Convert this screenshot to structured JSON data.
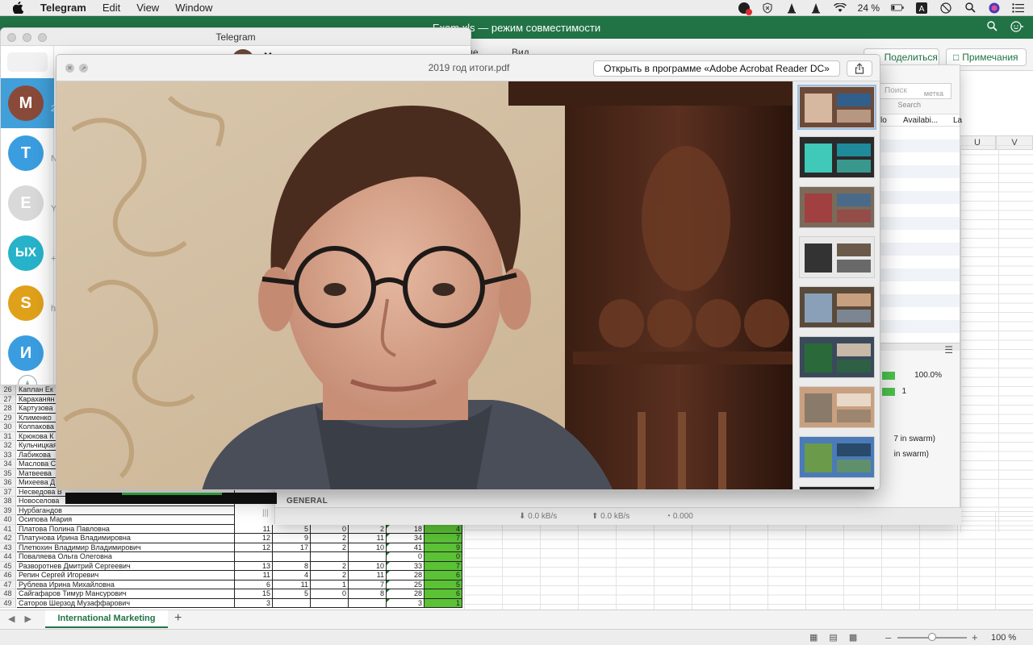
{
  "menubar": {
    "app": "Telegram",
    "items": [
      "Edit",
      "View",
      "Window"
    ],
    "battery": "24 %"
  },
  "excel": {
    "title": "Exam.xls — режим совместимости",
    "share_label": "Поделиться",
    "comments_label": "Примечания",
    "tab_partial_1": "ание",
    "tab_partial_2": "Вид",
    "columns": [
      "U",
      "V"
    ],
    "sheet_tab": "International Marketing",
    "zoom_level": "100 %",
    "rows": [
      {
        "n": "26",
        "name": "Каплан Ек",
        "v": [
          "",
          "",
          "",
          "",
          "",
          ""
        ]
      },
      {
        "n": "27",
        "name": "Караханян",
        "v": [
          "",
          "",
          "",
          "",
          "",
          ""
        ]
      },
      {
        "n": "28",
        "name": "Картузова",
        "v": [
          "",
          "",
          "",
          "",
          "",
          ""
        ]
      },
      {
        "n": "29",
        "name": "Клименко",
        "v": [
          "",
          "",
          "",
          "",
          "",
          ""
        ]
      },
      {
        "n": "30",
        "name": "Колпакова",
        "v": [
          "",
          "",
          "",
          "",
          "",
          ""
        ]
      },
      {
        "n": "31",
        "name": "Крюкова К",
        "v": [
          "",
          "",
          "",
          "",
          "",
          ""
        ]
      },
      {
        "n": "32",
        "name": "Кульчицкая",
        "v": [
          "",
          "",
          "",
          "",
          "",
          ""
        ]
      },
      {
        "n": "33",
        "name": "Лабикова",
        "v": [
          "",
          "",
          "",
          "",
          "",
          ""
        ]
      },
      {
        "n": "34",
        "name": "Маслова С",
        "v": [
          "",
          "",
          "",
          "",
          "",
          ""
        ]
      },
      {
        "n": "35",
        "name": "Матвеева",
        "v": [
          "",
          "",
          "",
          "",
          "",
          ""
        ]
      },
      {
        "n": "36",
        "name": "Михеева Д",
        "v": [
          "",
          "",
          "",
          "",
          "",
          ""
        ]
      },
      {
        "n": "37",
        "name": "Несведова В",
        "v": [
          "",
          "",
          "",
          "",
          "",
          ""
        ]
      },
      {
        "n": "38",
        "name": "Новоселова",
        "v": [
          "",
          "",
          "",
          "",
          "",
          ""
        ]
      },
      {
        "n": "39",
        "name": "Нурбагандов",
        "v": [
          "",
          "",
          "",
          "",
          "",
          ""
        ]
      },
      {
        "n": "40",
        "name": "Осипова Мария",
        "v": [
          "",
          "",
          "",
          "",
          "",
          ""
        ]
      },
      {
        "n": "41",
        "name": "Платова Полина Павловна",
        "v": [
          "11",
          "5",
          "0",
          "2",
          "18",
          "4"
        ]
      },
      {
        "n": "42",
        "name": "Платунова Ирина Владимировна",
        "v": [
          "12",
          "9",
          "2",
          "11",
          "34",
          "7"
        ]
      },
      {
        "n": "43",
        "name": "Плетюхин Владимир Владимирович",
        "v": [
          "12",
          "17",
          "2",
          "10",
          "41",
          "9"
        ]
      },
      {
        "n": "44",
        "name": "Поваляева Ольга Олеговна",
        "v": [
          "",
          "",
          "",
          "",
          "0",
          "0"
        ]
      },
      {
        "n": "45",
        "name": "Разворотнев Дмитрий Сергеевич",
        "v": [
          "13",
          "8",
          "2",
          "10",
          "33",
          "7"
        ]
      },
      {
        "n": "46",
        "name": "Репин Сергей Игоревич",
        "v": [
          "11",
          "4",
          "2",
          "11",
          "28",
          "6"
        ]
      },
      {
        "n": "47",
        "name": "Рублева Ирина Михайловна",
        "v": [
          "6",
          "11",
          "1",
          "7",
          "25",
          "5"
        ]
      },
      {
        "n": "48",
        "name": "Сайгафаров Тимур Мансурович",
        "v": [
          "15",
          "5",
          "0",
          "8",
          "28",
          "6"
        ]
      },
      {
        "n": "49",
        "name": "Саторов Шерзод Музаффарович",
        "v": [
          "3",
          "",
          "",
          "",
          "3",
          "1"
        ]
      }
    ]
  },
  "torrent": {
    "search_placeholder": "Поиск",
    "search_hint": "Search",
    "header_col1": "lo",
    "header_col2": "Availabi...",
    "header_col3": "La",
    "progress_pct": "100.0%",
    "progress_count": "1",
    "swarm_1": "7 in swarm)",
    "swarm_2": "in swarm)",
    "general_label": "GENERAL",
    "down_speed": "⬇ 0.0 kB/s",
    "up_speed": "⬆ 0.0 kB/s",
    "ratio": "◔ 0.000",
    "partial_label": "метка"
  },
  "telegram": {
    "title": "Telegram",
    "header_name": "Маргарита",
    "chats": [
      {
        "initial": "М",
        "sub": "2",
        "color": "#8a4a3a",
        "active": true
      },
      {
        "initial": "T",
        "sub": "N",
        "color": "#3a9de0",
        "active": false
      },
      {
        "initial": "E",
        "sub": "Y",
        "color": "#d9d9d9",
        "active": false
      },
      {
        "initial": "ЫХ",
        "sub": "+",
        "color": "#26b3c9",
        "active": false
      },
      {
        "initial": "S",
        "sub": "h",
        "color": "#e0a11a",
        "active": false
      },
      {
        "initial": "И",
        "sub": "",
        "color": "#3a9de0",
        "active": false
      }
    ]
  },
  "quicklook": {
    "title": "2019 год итоги.pdf",
    "open_button": "Открыть в программе «Adobe Acrobat Reader DC»",
    "thumbnail_count": 9
  }
}
